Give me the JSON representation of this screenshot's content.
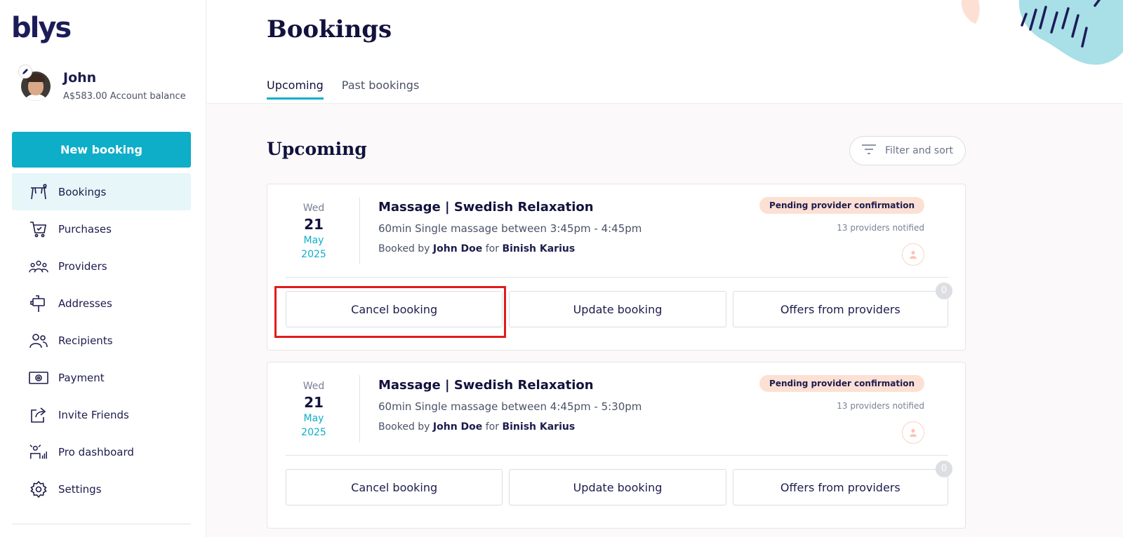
{
  "brand": {
    "logo_text": "blys",
    "accent_color": "#0eaec8",
    "highlight_color": "#e31b1b"
  },
  "profile": {
    "name": "John",
    "balance": "A$583.00 Account balance"
  },
  "sidebar": {
    "new_booking_label": "New booking",
    "items": [
      {
        "label": "Bookings",
        "icon": "massage-table-icon",
        "active": true
      },
      {
        "label": "Purchases",
        "icon": "cart-icon"
      },
      {
        "label": "Providers",
        "icon": "providers-icon"
      },
      {
        "label": "Addresses",
        "icon": "mailbox-icon"
      },
      {
        "label": "Recipients",
        "icon": "recipients-icon"
      },
      {
        "label": "Payment",
        "icon": "cash-icon"
      },
      {
        "label": "Invite Friends",
        "icon": "share-icon"
      },
      {
        "label": "Pro dashboard",
        "icon": "dashboard-icon"
      },
      {
        "label": "Settings",
        "icon": "gear-icon"
      }
    ]
  },
  "header": {
    "title": "Bookings",
    "tabs": [
      {
        "label": "Upcoming",
        "active": true
      },
      {
        "label": "Past bookings",
        "active": false
      }
    ]
  },
  "main": {
    "section_title": "Upcoming",
    "filter_label": "Filter and sort",
    "bookings": [
      {
        "date": {
          "dow": "Wed",
          "day": "21",
          "month": "May",
          "year": "2025"
        },
        "title": "Massage | Swedish Relaxation",
        "description": "60min Single massage between 3:45pm - 4:45pm",
        "booked_by_prefix": "Booked by",
        "booked_by": "John Doe",
        "for_word": "for",
        "recipient": "Binish Karius",
        "status": "Pending provider confirmation",
        "notified": "13 providers notified",
        "actions": {
          "cancel": "Cancel booking",
          "update": "Update booking",
          "offers": "Offers from providers"
        },
        "offers_count": "0"
      },
      {
        "date": {
          "dow": "Wed",
          "day": "21",
          "month": "May",
          "year": "2025"
        },
        "title": "Massage | Swedish Relaxation",
        "description": "60min Single massage between 4:45pm - 5:30pm",
        "booked_by_prefix": "Booked by",
        "booked_by": "John Doe",
        "for_word": "for",
        "recipient": "Binish Karius",
        "status": "Pending provider confirmation",
        "notified": "13 providers notified",
        "actions": {
          "cancel": "Cancel booking",
          "update": "Update booking",
          "offers": "Offers from providers"
        },
        "offers_count": "0"
      }
    ]
  }
}
